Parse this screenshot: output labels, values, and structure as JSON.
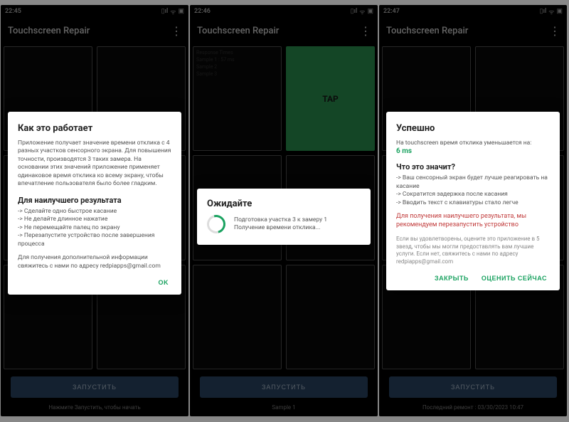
{
  "app_title": "Touchscreen Repair",
  "screens": {
    "s1": {
      "time": "22:45",
      "run": "ЗАПУСТИТЬ",
      "footer": "Нажмите Запустить, чтобы начать"
    },
    "s2": {
      "time": "22:46",
      "run": "ЗАПУСТИТЬ",
      "footer": "Sample 1",
      "cell0": {
        "l1": "Response Times",
        "l2": "Sample 1 : 57 ms",
        "l3": "Sample 2",
        "l4": "Sample 3"
      },
      "tap": "TAP"
    },
    "s3": {
      "time": "22:47",
      "run": "ЗАПУСТИТЬ",
      "footer": "Последний ремонт : 03/30/2023 10:47"
    }
  },
  "dlg1": {
    "title": "Как это работает",
    "p1": "Приложение получает значение времени отклика с 4 разных участков сенсорного экрана. Для повышения точности, производятся 3 таких замера. На основании этих значений приложение применяет одинаковое время отклика ко всему экрану, чтобы впечатление пользователя было более гладким.",
    "sub": "Для наилучшего результата",
    "b1": "-> Сделайте одно быстрое касание",
    "b2": "-> Не делайте длинное нажатие",
    "b3": "-> Не перемещайте палец по экрану",
    "b4": "-> Перезапустите устройство после завершения процесса",
    "p2": "Для получения дополнительной информации свяжитесь с нами по адресу redpiapps@gmail.com",
    "ok": "OK"
  },
  "dlg2": {
    "title": "Ожидайте",
    "msg": "Подготовка участка 3 к замеру 1\nПолучение времени отклика..."
  },
  "dlg3": {
    "title": "Успешно",
    "l1a": "На touchscreen время отклика уменьшается на:",
    "l1b": "6 ms",
    "sub": "Что это значит?",
    "b1": "-> Ваш сенсорный экран будет лучше реагировать на касание",
    "b2": "-> Сократится задержка после касания",
    "b3": "-> Вводить текст с клавиатуры стало легче",
    "warn": "Для получения наилучшего результата, мы рекомендуем перезапустить устройство",
    "mute": "Если вы удовлетворены, оцените это приложение в 5 звезд, чтобы мы могли предоставлять вам лучшие услуги. Если нет, свяжитесь с нами по адресу redpiapps@gmail.com",
    "close": "ЗАКРЫТЬ",
    "rate": "ОЦЕНИТЬ СЕЙЧАС"
  }
}
